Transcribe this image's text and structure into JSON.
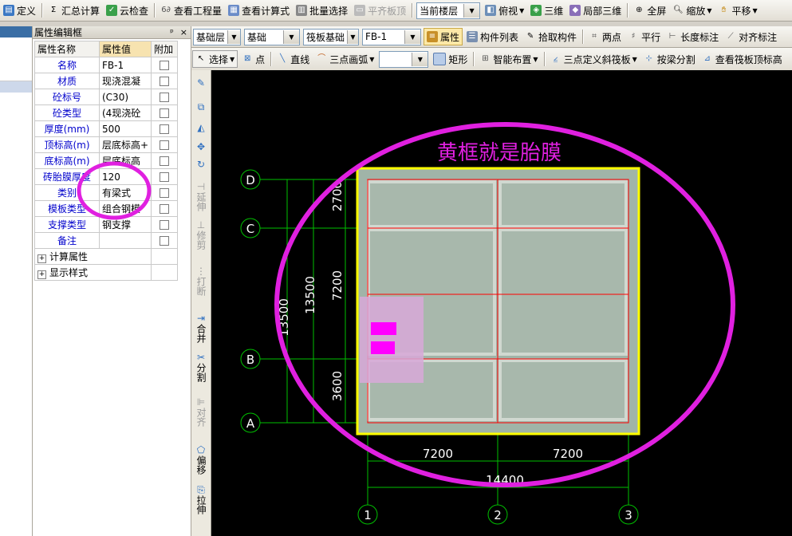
{
  "toolbar1": {
    "define": "定义",
    "sum_calc": "汇总计算",
    "cloud_check": "云检查",
    "view_quantity": "查看工程量",
    "view_formula": "查看计算式",
    "batch_select": "批量选择",
    "align_top": "平齐板顶",
    "floor_combo": "当前楼层",
    "top_view": "俯视",
    "three_d": "三维",
    "local_3d": "局部三维",
    "fullscreen": "全屏",
    "zoom": "缩放",
    "pan": "平移"
  },
  "toolbar2": {
    "layer_combo": "基础层",
    "cat_combo": "基础",
    "type_combo": "筏板基础",
    "item_combo": "FB-1",
    "property": "属性",
    "component_list": "构件列表",
    "pick_component": "拾取构件",
    "two_points": "两点",
    "parallel": "平行",
    "length_mark": "长度标注",
    "align_mark": "对齐标注"
  },
  "toolbar3": {
    "select": "选择",
    "point": "点",
    "line": "直线",
    "arc": "三点画弧",
    "arc_combo": "",
    "rect": "矩形",
    "smart_layout": "智能布置",
    "slope_slab": "三点定义斜筏板",
    "split_by_beam": "按梁分割",
    "view_top_elev": "查看筏板顶标高"
  },
  "prop_panel": {
    "title": "属性编辑框",
    "pin": "ᵖ",
    "close": "×",
    "col_name": "属性名称",
    "col_value": "属性值",
    "col_extra": "附加",
    "rows": [
      {
        "name": "名称",
        "value": "FB-1"
      },
      {
        "name": "材质",
        "value": "现浇混凝"
      },
      {
        "name": "砼标号",
        "value": "(C30)"
      },
      {
        "name": "砼类型",
        "value": "(4现浇砼"
      },
      {
        "name": "厚度(mm)",
        "value": "500"
      },
      {
        "name": "顶标高(m)",
        "value": "层底标高+"
      },
      {
        "name": "底标高(m)",
        "value": "层底标高"
      },
      {
        "name": "砖胎膜厚度",
        "value": "120"
      },
      {
        "name": "类别",
        "value": "有梁式"
      },
      {
        "name": "模板类型",
        "value": "组合钢模"
      },
      {
        "name": "支撑类型",
        "value": "钢支撑"
      },
      {
        "name": "备注",
        "value": ""
      }
    ],
    "group1": "计算属性",
    "group2": "显示样式"
  },
  "vtools": {
    "extend": "延伸",
    "trim": "修剪",
    "break": "打断",
    "merge": "合并",
    "split": "分割",
    "align": "对齐",
    "offset": "偏移",
    "stretch": "拉伸"
  },
  "drawing": {
    "annotation": "黄框就是胎膜",
    "axis_rows": [
      "D",
      "C",
      "B",
      "A"
    ],
    "axis_cols": [
      "1",
      "2",
      "3"
    ],
    "dim_left_total1": "13500",
    "dim_left_total2": "13500",
    "dim_seg_top": "2700",
    "dim_seg_mid": "7200",
    "dim_seg_bot": "3600",
    "dim_bottom_1": "7200",
    "dim_bottom_2": "7200",
    "dim_bottom_total": "14400"
  },
  "colors": {
    "accent_magenta": "#e020e0",
    "frame_yellow": "#ffff00",
    "slab_gray": "#9fb3a6",
    "axis_green": "#00c000",
    "grid_red": "#ff0000"
  }
}
